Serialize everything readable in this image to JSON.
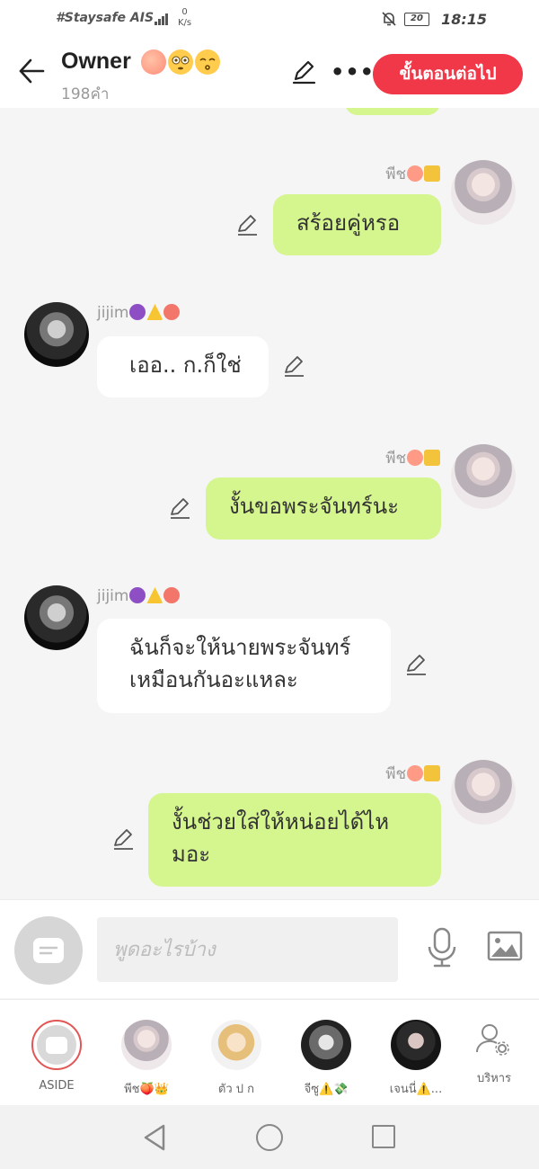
{
  "status_bar": {
    "carrier": "#Staysafe AIS",
    "network_type": "4G",
    "speed_value": "0",
    "speed_unit": "K/s",
    "battery": "20",
    "time": "18:15"
  },
  "header": {
    "title": "Owner",
    "title_emojis": [
      "peach",
      "flushed-face",
      "kissing-face"
    ],
    "word_count": "198คำ",
    "next_button_label": "ขั้นตอนต่อไป",
    "more_label": "•••"
  },
  "messages": [
    {
      "side": "me",
      "sender": "พีช",
      "sender_badges": [
        "peach",
        "crown"
      ],
      "text": "สร้อยคู่หรอ"
    },
    {
      "side": "other",
      "sender": "jijim",
      "sender_badges": [
        "devil",
        "warning",
        "tongue-face"
      ],
      "text": "เออ.. ก.ก็ใช่"
    },
    {
      "side": "me",
      "sender": "พีช",
      "sender_badges": [
        "peach",
        "crown"
      ],
      "text": "งั้นขอพระจันทร์นะ"
    },
    {
      "side": "other",
      "sender": "jijim",
      "sender_badges": [
        "devil",
        "warning",
        "tongue-face"
      ],
      "text_lines": [
        "ฉันก็จะให้นายพระจันทร์",
        "เหมือนกันอะแหละ"
      ]
    },
    {
      "side": "me",
      "sender": "พีช",
      "sender_badges": [
        "peach",
        "crown"
      ],
      "text_lines": [
        "งั้นช่วยใส่ให้หน่อยได้ไห",
        "มอะ"
      ]
    }
  ],
  "input_bar": {
    "placeholder": "พูดอะไรบ้าง"
  },
  "members": [
    {
      "label": "ASIDE"
    },
    {
      "label": "พีช🍑👑"
    },
    {
      "label": "ตัว ป ก"
    },
    {
      "label": "จีซู⚠️💸"
    },
    {
      "label": "เจนนี่⚠️..."
    },
    {
      "label": "บริหาร"
    }
  ],
  "colors": {
    "accent": "#f03848",
    "my_bubble": "#d5f58e",
    "other_bubble": "#ffffff",
    "background": "#f5f5f5"
  }
}
